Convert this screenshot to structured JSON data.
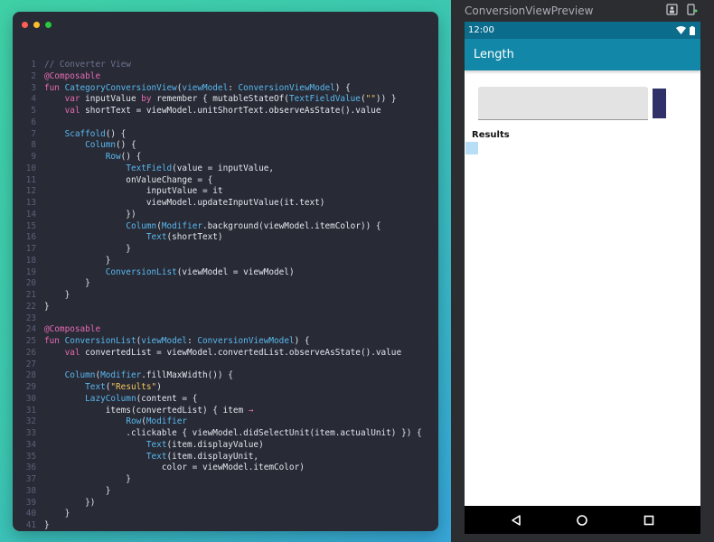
{
  "editor": {
    "window_dots": [
      "#ff5f57",
      "#febc2e",
      "#28c840"
    ],
    "lines": [
      [
        [
          "c",
          "// Converter View"
        ]
      ],
      [
        [
          "k",
          "@Composable"
        ]
      ],
      [
        [
          "k",
          "fun "
        ],
        [
          "f",
          "CategoryConversionView"
        ],
        [
          "p",
          "("
        ],
        [
          "f",
          "viewModel"
        ],
        [
          "p",
          ": "
        ],
        [
          "t",
          "ConversionViewModel"
        ],
        [
          "p",
          ") {"
        ]
      ],
      [
        [
          "p",
          "    "
        ],
        [
          "k",
          "var "
        ],
        [
          "p",
          "inputValue "
        ],
        [
          "k",
          "by "
        ],
        [
          "p",
          "remember { mutableStateOf("
        ],
        [
          "t",
          "TextFieldValue"
        ],
        [
          "p",
          "("
        ],
        [
          "s",
          "\"\""
        ],
        [
          "p",
          ")) }"
        ]
      ],
      [
        [
          "p",
          "    "
        ],
        [
          "k",
          "val "
        ],
        [
          "p",
          "shortText = viewModel.unitShortText.observeAsState().value"
        ]
      ],
      [
        [
          "p",
          ""
        ]
      ],
      [
        [
          "p",
          "    "
        ],
        [
          "t",
          "Scaffold"
        ],
        [
          "p",
          "() {"
        ]
      ],
      [
        [
          "p",
          "        "
        ],
        [
          "t",
          "Column"
        ],
        [
          "p",
          "() {"
        ]
      ],
      [
        [
          "p",
          "            "
        ],
        [
          "t",
          "Row"
        ],
        [
          "p",
          "() {"
        ]
      ],
      [
        [
          "p",
          "                "
        ],
        [
          "t",
          "TextField"
        ],
        [
          "p",
          "(value = inputValue,"
        ]
      ],
      [
        [
          "p",
          "                onValueChange = {"
        ]
      ],
      [
        [
          "p",
          "                    inputValue = it"
        ]
      ],
      [
        [
          "p",
          "                    viewModel.updateInputValue(it.text)"
        ]
      ],
      [
        [
          "p",
          "                })"
        ]
      ],
      [
        [
          "p",
          "                "
        ],
        [
          "t",
          "Column"
        ],
        [
          "p",
          "("
        ],
        [
          "t",
          "Modifier"
        ],
        [
          "p",
          ".background(viewModel.itemColor)) {"
        ]
      ],
      [
        [
          "p",
          "                    "
        ],
        [
          "t",
          "Text"
        ],
        [
          "p",
          "(shortText)"
        ]
      ],
      [
        [
          "p",
          "                }"
        ]
      ],
      [
        [
          "p",
          "            }"
        ]
      ],
      [
        [
          "p",
          "            "
        ],
        [
          "t",
          "ConversionList"
        ],
        [
          "p",
          "(viewModel = viewModel)"
        ]
      ],
      [
        [
          "p",
          "        }"
        ]
      ],
      [
        [
          "p",
          "    }"
        ]
      ],
      [
        [
          "p",
          "}"
        ]
      ],
      [
        [
          "p",
          ""
        ]
      ],
      [
        [
          "k",
          "@Composable"
        ]
      ],
      [
        [
          "k",
          "fun "
        ],
        [
          "f",
          "ConversionList"
        ],
        [
          "p",
          "("
        ],
        [
          "f",
          "viewModel"
        ],
        [
          "p",
          ": "
        ],
        [
          "t",
          "ConversionViewModel"
        ],
        [
          "p",
          ") {"
        ]
      ],
      [
        [
          "p",
          "    "
        ],
        [
          "k",
          "val "
        ],
        [
          "p",
          "convertedList = viewModel.convertedList.observeAsState().value"
        ]
      ],
      [
        [
          "p",
          ""
        ]
      ],
      [
        [
          "p",
          "    "
        ],
        [
          "t",
          "Column"
        ],
        [
          "p",
          "("
        ],
        [
          "t",
          "Modifier"
        ],
        [
          "p",
          ".fillMaxWidth()) {"
        ]
      ],
      [
        [
          "p",
          "        "
        ],
        [
          "t",
          "Text"
        ],
        [
          "p",
          "("
        ],
        [
          "s",
          "\"Results\""
        ],
        [
          "p",
          ")"
        ]
      ],
      [
        [
          "p",
          "        "
        ],
        [
          "t",
          "LazyColumn"
        ],
        [
          "p",
          "(content = {"
        ]
      ],
      [
        [
          "p",
          "            items(convertedList) { item "
        ],
        [
          "k",
          "→"
        ]
      ],
      [
        [
          "p",
          "                "
        ],
        [
          "t",
          "Row"
        ],
        [
          "p",
          "("
        ],
        [
          "t",
          "Modifier"
        ]
      ],
      [
        [
          "p",
          "                .clickable { viewModel.didSelectUnit(item.actualUnit) }) {"
        ]
      ],
      [
        [
          "p",
          "                    "
        ],
        [
          "t",
          "Text"
        ],
        [
          "p",
          "(item.displayValue)"
        ]
      ],
      [
        [
          "p",
          "                    "
        ],
        [
          "t",
          "Text"
        ],
        [
          "p",
          "(item.displayUnit,"
        ]
      ],
      [
        [
          "p",
          "                       color = viewModel.itemColor)"
        ]
      ],
      [
        [
          "p",
          "                }"
        ]
      ],
      [
        [
          "p",
          "            }"
        ]
      ],
      [
        [
          "p",
          "        })"
        ]
      ],
      [
        [
          "p",
          "    }"
        ]
      ],
      [
        [
          "p",
          "}"
        ]
      ]
    ]
  },
  "preview": {
    "title": "ConversionViewPreview",
    "device": {
      "status_time": "12:00",
      "app_title": "Length",
      "results_label": "Results"
    }
  },
  "colors": {
    "app_bar": "#1287a8",
    "status_bar": "#0c6c8c",
    "unit_box": "#2f3168",
    "result_item": "#b8def7"
  }
}
